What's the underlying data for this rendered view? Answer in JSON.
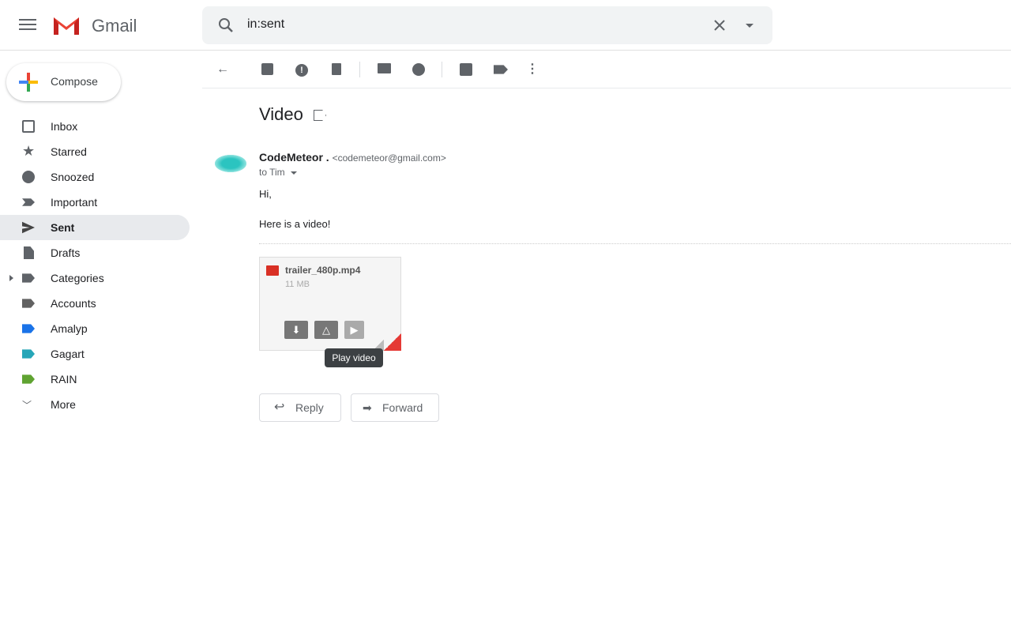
{
  "header": {
    "brand": "Gmail",
    "search_value": "in:sent"
  },
  "compose_label": "Compose",
  "sidebar": {
    "items": [
      {
        "label": "Inbox",
        "icon": "inbox-icon"
      },
      {
        "label": "Starred",
        "icon": "star-icon"
      },
      {
        "label": "Snoozed",
        "icon": "clock-icon"
      },
      {
        "label": "Important",
        "icon": "important-icon"
      },
      {
        "label": "Sent",
        "icon": "send-icon",
        "active": true
      },
      {
        "label": "Drafts",
        "icon": "draft-icon"
      },
      {
        "label": "Categories",
        "icon": "label-icon"
      },
      {
        "label": "Accounts",
        "icon": "label-icon",
        "color": "#616161"
      },
      {
        "label": "Amalyp",
        "icon": "label-icon",
        "color": "#1a73e8"
      },
      {
        "label": "Gagart",
        "icon": "label-icon",
        "color": "#26a6b8"
      },
      {
        "label": "RAIN",
        "icon": "label-icon",
        "color": "#5fa331"
      },
      {
        "label": "More",
        "icon": "chevron-down-icon"
      }
    ]
  },
  "message": {
    "subject": "Video",
    "sender_name": "CodeMeteor .",
    "sender_email": "<codemeteor@gmail.com>",
    "to": "to Tim",
    "body_line1": "Hi,",
    "body_line2": "Here is a video!",
    "attachment": {
      "name": "trailer_480p.mp4",
      "size": "11 MB",
      "tooltip": "Play video"
    },
    "reply_label": "Reply",
    "forward_label": "Forward"
  }
}
